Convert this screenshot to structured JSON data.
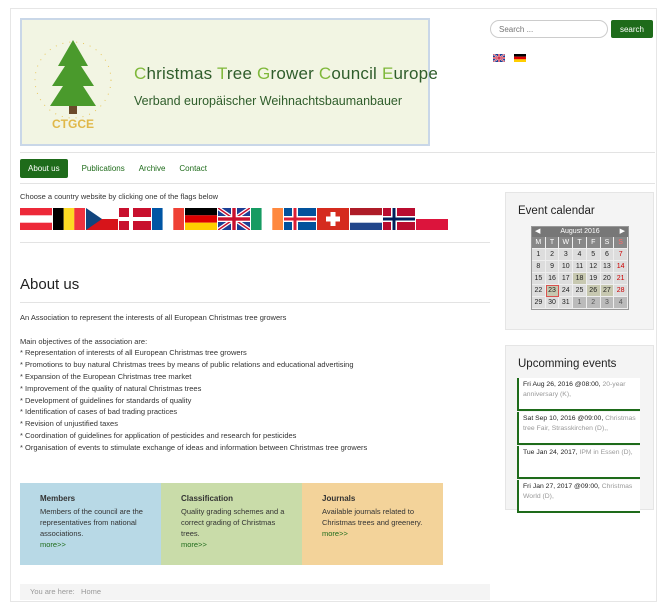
{
  "header": {
    "title_line1": "Christmas Tree Grower Council Europe",
    "title_line2": "Verband europäischer Weihnachtsbaumanbauer",
    "logo_text": "CTGCE",
    "search_placeholder": "Search ...",
    "search_button": "search",
    "languages": [
      "uk-flag-icon",
      "de-flag-icon"
    ]
  },
  "nav": {
    "items": [
      "About us",
      "Publications",
      "Archive",
      "Contact"
    ]
  },
  "countries": {
    "prompt": "Choose a country website by clicking one of the flags below",
    "flags": [
      "AT",
      "BE",
      "CZ",
      "DK",
      "FR",
      "DE",
      "GB",
      "IE",
      "IS",
      "CH",
      "NL",
      "NO",
      "PL"
    ]
  },
  "main": {
    "title": "About us",
    "intro": "An Association to represent the interests of all European Christmas tree growers",
    "objectives_title": "Main objectives of the association are:",
    "objectives": [
      "* Representation of interests of all European Christmas tree growers",
      "* Promotions to buy natural Christmas trees by means of public relations and educational advertising",
      "* Expansion of the European Christmas tree market",
      "* Improvement of the quality of natural Christmas trees",
      "* Development of guidelines for standards of quality",
      "* Identification of cases of bad trading practices",
      "* Revision of unjustified taxes",
      "* Coordination of guidelines for application of pesticides  and research for pesticides",
      "* Organisation of events to stimulate exchange of ideas and information between Christmas tree growers"
    ]
  },
  "boxes": [
    {
      "title": "Members",
      "text": "Members of the council are the representatives from national associations.",
      "more": "more>>",
      "color": "#b8d9e6"
    },
    {
      "title": "Classification",
      "text": "Quality grading schemes and a correct grading of Christmas trees.",
      "more": "more>>",
      "color": "#c9dca9"
    },
    {
      "title": "Journals",
      "text": "Available journals related to Christmas trees and greenery.",
      "more": "more>>",
      "color": "#f3d39a"
    }
  ],
  "breadcrumb": {
    "label": "You are here:",
    "home": "Home"
  },
  "calendar": {
    "title": "Event calendar",
    "month": "August 2016",
    "dow": [
      "M",
      "T",
      "W",
      "T",
      "F",
      "S",
      "S"
    ]
  },
  "events": {
    "title": "Upcomming events",
    "items": [
      {
        "date": "Fri Aug 26, 2016 @08:00,",
        "title": "20-year anniversary (K),"
      },
      {
        "date": "Sat Sep 10, 2016 @09:00,",
        "title": "Christmas tree Fair, Strasskirchen (D),,"
      },
      {
        "date": "Tue Jan 24, 2017,",
        "title": "IPM in Essen (D),"
      },
      {
        "date": "Fri Jan 27, 2017 @09:00,",
        "title": "Christmas World (D),"
      }
    ]
  },
  "colors": {
    "accent": "#1e6b1a",
    "title_green": "#7fb83a"
  }
}
